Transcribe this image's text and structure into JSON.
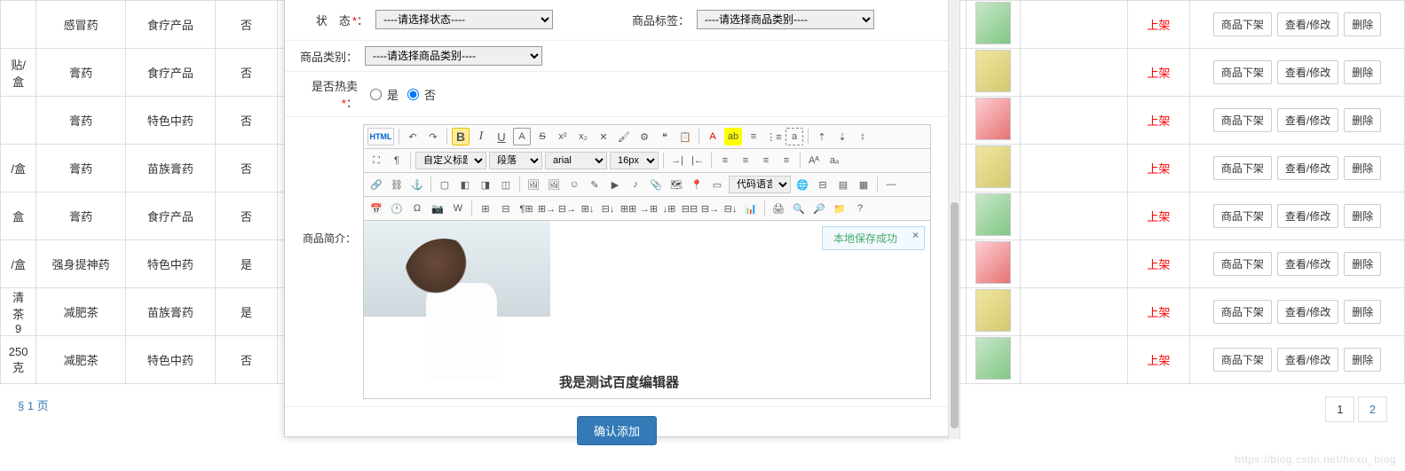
{
  "form": {
    "status_label": "状　态",
    "status_placeholder": "----请选择状态----",
    "tag_label": "商品标签：",
    "tag_placeholder": "----请选择商品类别----",
    "category_label": "商品类别：",
    "category_placeholder": "----请选择商品类别----",
    "hot_label": "是否热卖",
    "hot_yes": "是",
    "hot_no": "否",
    "intro_label": "商品简介：",
    "submit": "确认添加"
  },
  "editor": {
    "html_btn": "HTML",
    "heading_sel": "自定义标题",
    "para_sel": "段落",
    "font_sel": "arial",
    "size_sel": "16px",
    "lang_sel": "代码语言",
    "caption": "我是测试百度编辑器",
    "toast": "本地保存成功",
    "toast_close": "×"
  },
  "table": {
    "rows": [
      {
        "c0": "",
        "c1": "感冒药",
        "c2": "食疗产品",
        "c3": "否",
        "status": "上架"
      },
      {
        "c0": "贴/盒",
        "c1": "膏药",
        "c2": "食疗产品",
        "c3": "否",
        "status": "上架"
      },
      {
        "c0": "",
        "c1": "膏药",
        "c2": "特色中药",
        "c3": "否",
        "status": "上架"
      },
      {
        "c0": "/盒",
        "c1": "膏药",
        "c2": "苗族膏药",
        "c3": "否",
        "status": "上架"
      },
      {
        "c0": "盒",
        "c1": "膏药",
        "c2": "食疗产品",
        "c3": "否",
        "status": "上架"
      },
      {
        "c0": "/盒",
        "c1": "强身提神药",
        "c2": "特色中药",
        "c3": "是",
        "status": "上架"
      },
      {
        "c0": "清茶 9",
        "c1": "减肥茶",
        "c2": "苗族膏药",
        "c3": "是",
        "status": "上架"
      },
      {
        "c0": "250克",
        "c1": "减肥茶",
        "c2": "特色中药",
        "c3": "否",
        "status": "上架"
      }
    ],
    "actions": {
      "off": "商品下架",
      "view": "查看/修改",
      "del": "删除"
    }
  },
  "pagination": {
    "info": "§ 1 页",
    "p1": "1",
    "p2": "2"
  },
  "watermark": "https://blog.csdn.net/hexu_blog"
}
